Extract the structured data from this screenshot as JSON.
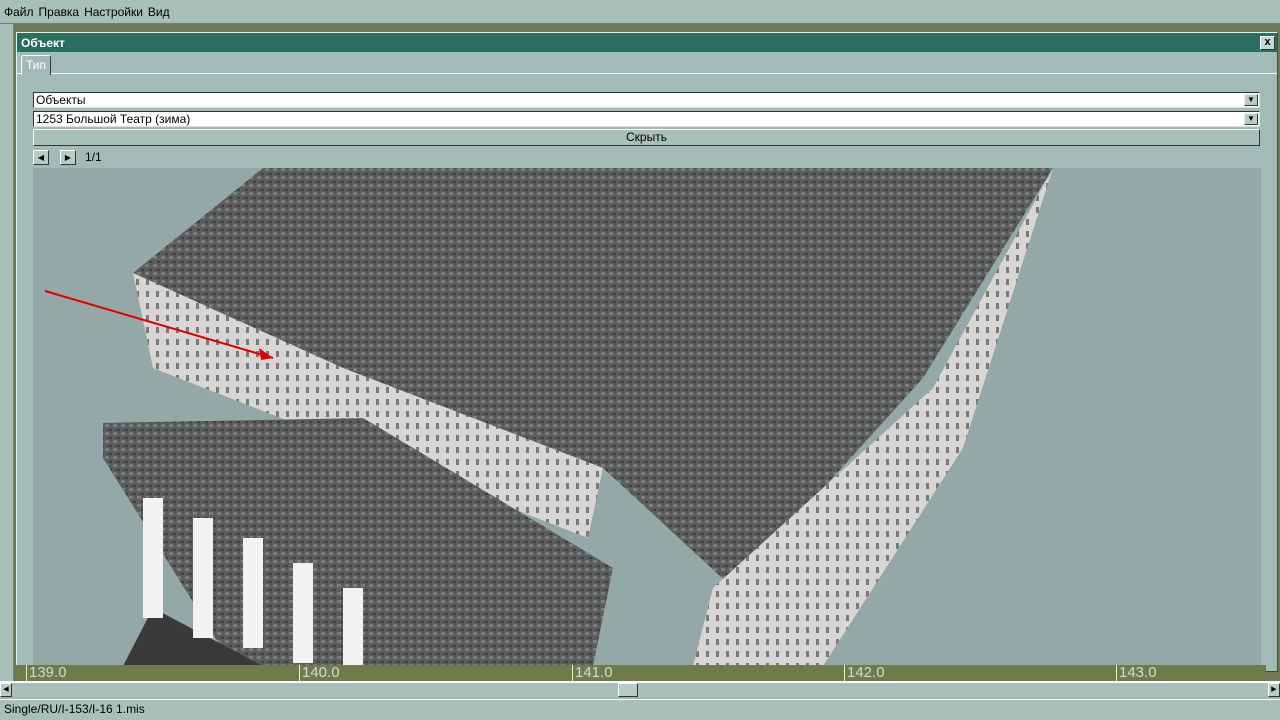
{
  "menu": {
    "items": [
      "Файл",
      "Правка",
      "Настройки",
      "Вид"
    ]
  },
  "window": {
    "title": "Объект",
    "close_label": "x",
    "tabs": [
      "Тип"
    ]
  },
  "form": {
    "category": "Объекты",
    "object": "1253 Большой Театр (зима)",
    "hide_label": "Скрыть",
    "page": "1/1"
  },
  "ruler": {
    "ticks": [
      "139.0",
      "140.0",
      "141.0",
      "142.0",
      "143.0"
    ]
  },
  "status": {
    "text": "Single/RU/I-153/I-16  1.mis"
  },
  "colors": {
    "title": "#2a6e62",
    "window": "#a3bbb6",
    "viewport": "#95a8a8"
  }
}
